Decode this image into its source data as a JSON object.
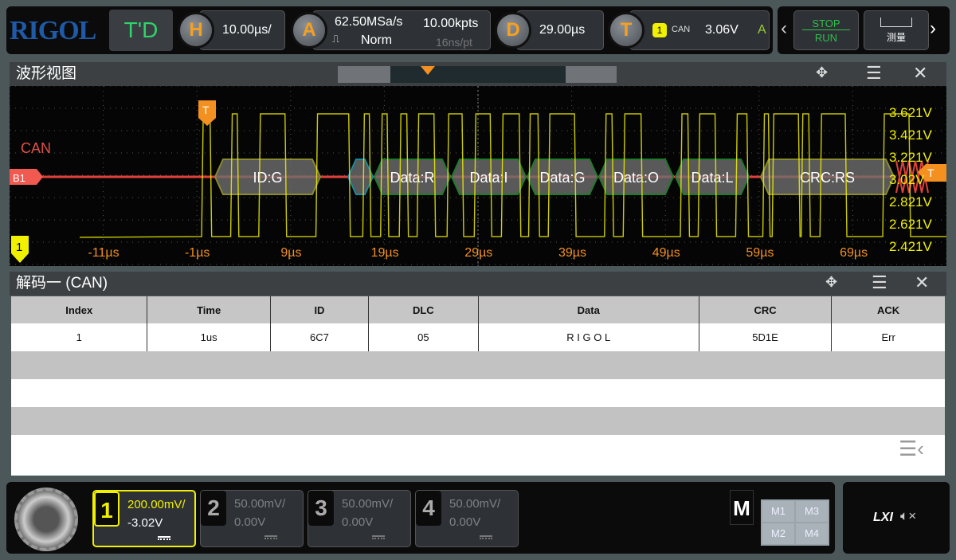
{
  "top": {
    "logo": "RIGOL",
    "mode": "T'D",
    "h_label": "H",
    "timebase": "10.00µs/",
    "a_label": "A",
    "sample_rate": "62.50MSa/s",
    "memory_depth": "10.00kpts",
    "acq_mode": "Norm",
    "time_per_pt": "16ns/pt",
    "d_label": "D",
    "delay": "29.00µs",
    "t_label": "T",
    "trig_source": "1",
    "trig_type": "CAN",
    "trig_level": "3.06V",
    "trig_sweep": "A",
    "stop_label": "STOP",
    "run_label": "RUN",
    "measure_label": "测量"
  },
  "waveform": {
    "title": "波形视图",
    "bus_label": "CAN",
    "bus_name": "B1",
    "channel_marker": "1",
    "trigger_marker": "T",
    "time_ticks": [
      "-11µs",
      "-1µs",
      "9µs",
      "19µs",
      "29µs",
      "39µs",
      "49µs",
      "59µs",
      "69µs"
    ],
    "volt_ticks": [
      "3.621V",
      "3.421V",
      "3.221V",
      "3.02V",
      "2.821V",
      "2.621V",
      "2.421V"
    ],
    "decode_segments": [
      {
        "label": "ID:G",
        "kind": "id"
      },
      {
        "label": "",
        "kind": "ctrl"
      },
      {
        "label": "Data:R",
        "kind": "data"
      },
      {
        "label": "Data:I",
        "kind": "data"
      },
      {
        "label": "Data:G",
        "kind": "data"
      },
      {
        "label": "Data:O",
        "kind": "data"
      },
      {
        "label": "Data:L",
        "kind": "data"
      },
      {
        "label": "CRC:RS",
        "kind": "crc"
      }
    ],
    "signal_high_level_v": 3.6,
    "signal_low_level_v": 2.5,
    "signal_high_intervals_us": [
      [
        -0.5,
        0.4
      ],
      [
        2.6,
        3.3
      ],
      [
        5.6,
        8.4
      ],
      [
        11.7,
        15.2
      ],
      [
        16.7,
        17.4
      ],
      [
        18.6,
        19.3
      ],
      [
        20.6,
        21.4
      ],
      [
        22.5,
        24.3
      ],
      [
        25.7,
        27.3
      ],
      [
        28.6,
        30.3
      ],
      [
        31.5,
        33.4
      ],
      [
        34.4,
        35.4
      ],
      [
        36.5,
        39.3
      ],
      [
        42.5,
        43.3
      ],
      [
        44.5,
        46.4
      ],
      [
        50.6,
        51.4
      ],
      [
        52.5,
        54.3
      ],
      [
        56.5,
        57.7
      ],
      [
        59.4,
        60.0
      ],
      [
        60.4,
        63.2
      ],
      [
        63.5,
        64.3
      ],
      [
        65.5,
        68.2
      ],
      [
        72.2,
        75
      ]
    ]
  },
  "decode": {
    "title": "解码一 (CAN)",
    "columns": [
      "Index",
      "Time",
      "ID",
      "DLC",
      "Data",
      "CRC",
      "ACK"
    ],
    "rows": [
      [
        "1",
        "1us",
        "6C7",
        "05",
        "R I G O L",
        "5D1E",
        "Err"
      ]
    ]
  },
  "channels": [
    {
      "num": "1",
      "scale": "200.00mV/",
      "offset": "-3.02V",
      "active": true
    },
    {
      "num": "2",
      "scale": "50.00mV/",
      "offset": "0.00V"
    },
    {
      "num": "3",
      "scale": "50.00mV/",
      "offset": "0.00V"
    },
    {
      "num": "4",
      "scale": "50.00mV/",
      "offset": "0.00V"
    }
  ],
  "math": {
    "label": "M",
    "items": [
      "M1",
      "M3",
      "M2",
      "M4"
    ]
  },
  "status": {
    "lxi": "LXI"
  },
  "colors": {
    "ch1": "#f0f000",
    "bus": "#e0403a",
    "trigger": "#f39020",
    "data_frame": "#1f7a2c",
    "id_frame": "#8a8a30",
    "time_label": "#f39020"
  }
}
